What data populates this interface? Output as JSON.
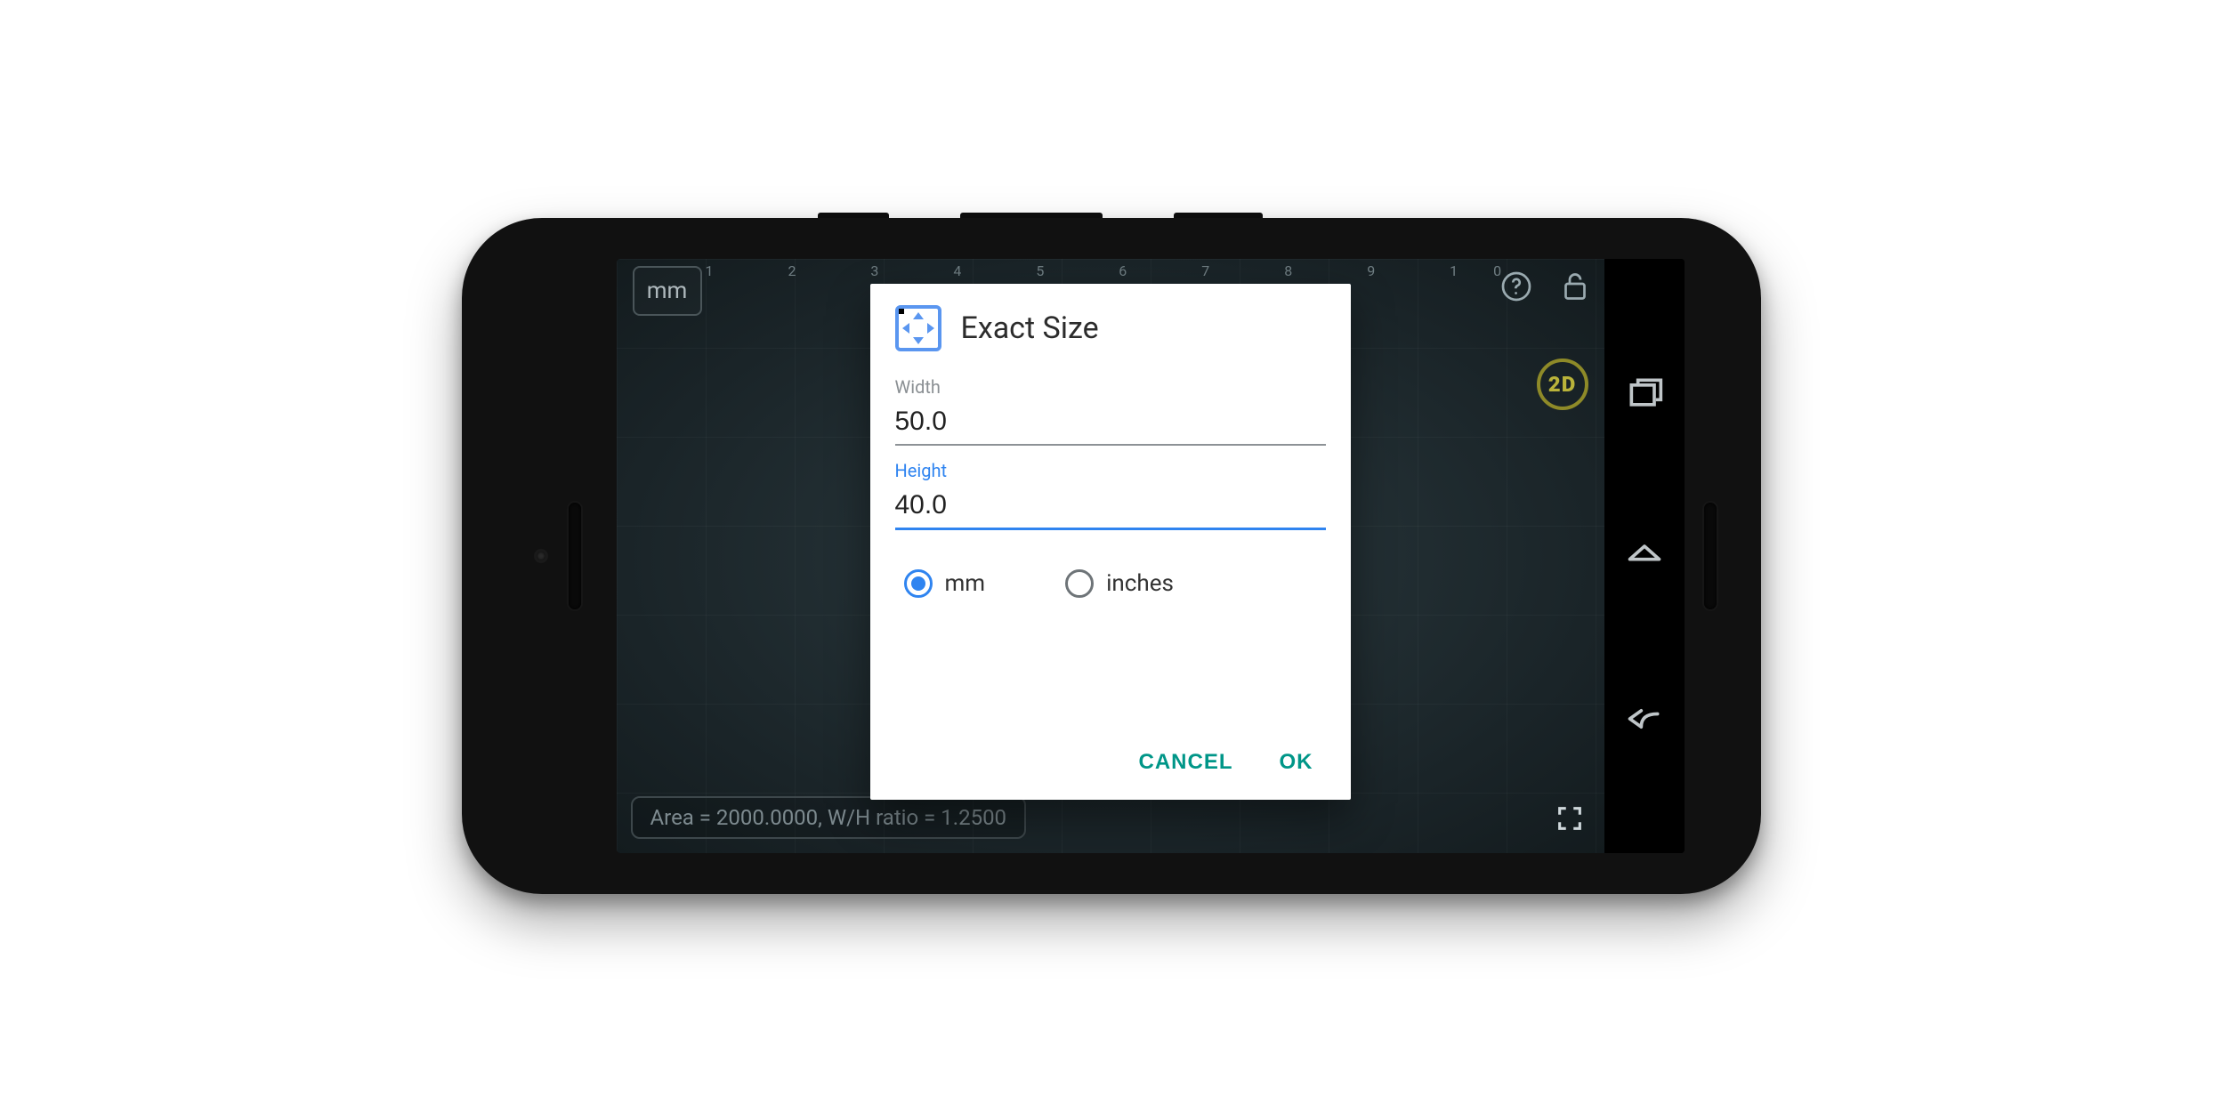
{
  "app": {
    "unit_chip": "mm",
    "ruler_marks": "1   2   3   4   5   6   7   8   9   10",
    "status_text": "Area = 2000.0000, W/H ratio = 1.2500",
    "badge_2d": "2D"
  },
  "dialog": {
    "title": "Exact Size",
    "width_label": "Width",
    "width_value": "50.0",
    "height_label": "Height",
    "height_value": "40.0",
    "unit_options": {
      "mm": "mm",
      "inches": "inches"
    },
    "selected_unit": "mm",
    "cancel": "CANCEL",
    "ok": "OK"
  },
  "colors": {
    "accent_blue": "#2f84f0",
    "accent_teal": "#009688",
    "accent_gold": "#b9b33a"
  }
}
